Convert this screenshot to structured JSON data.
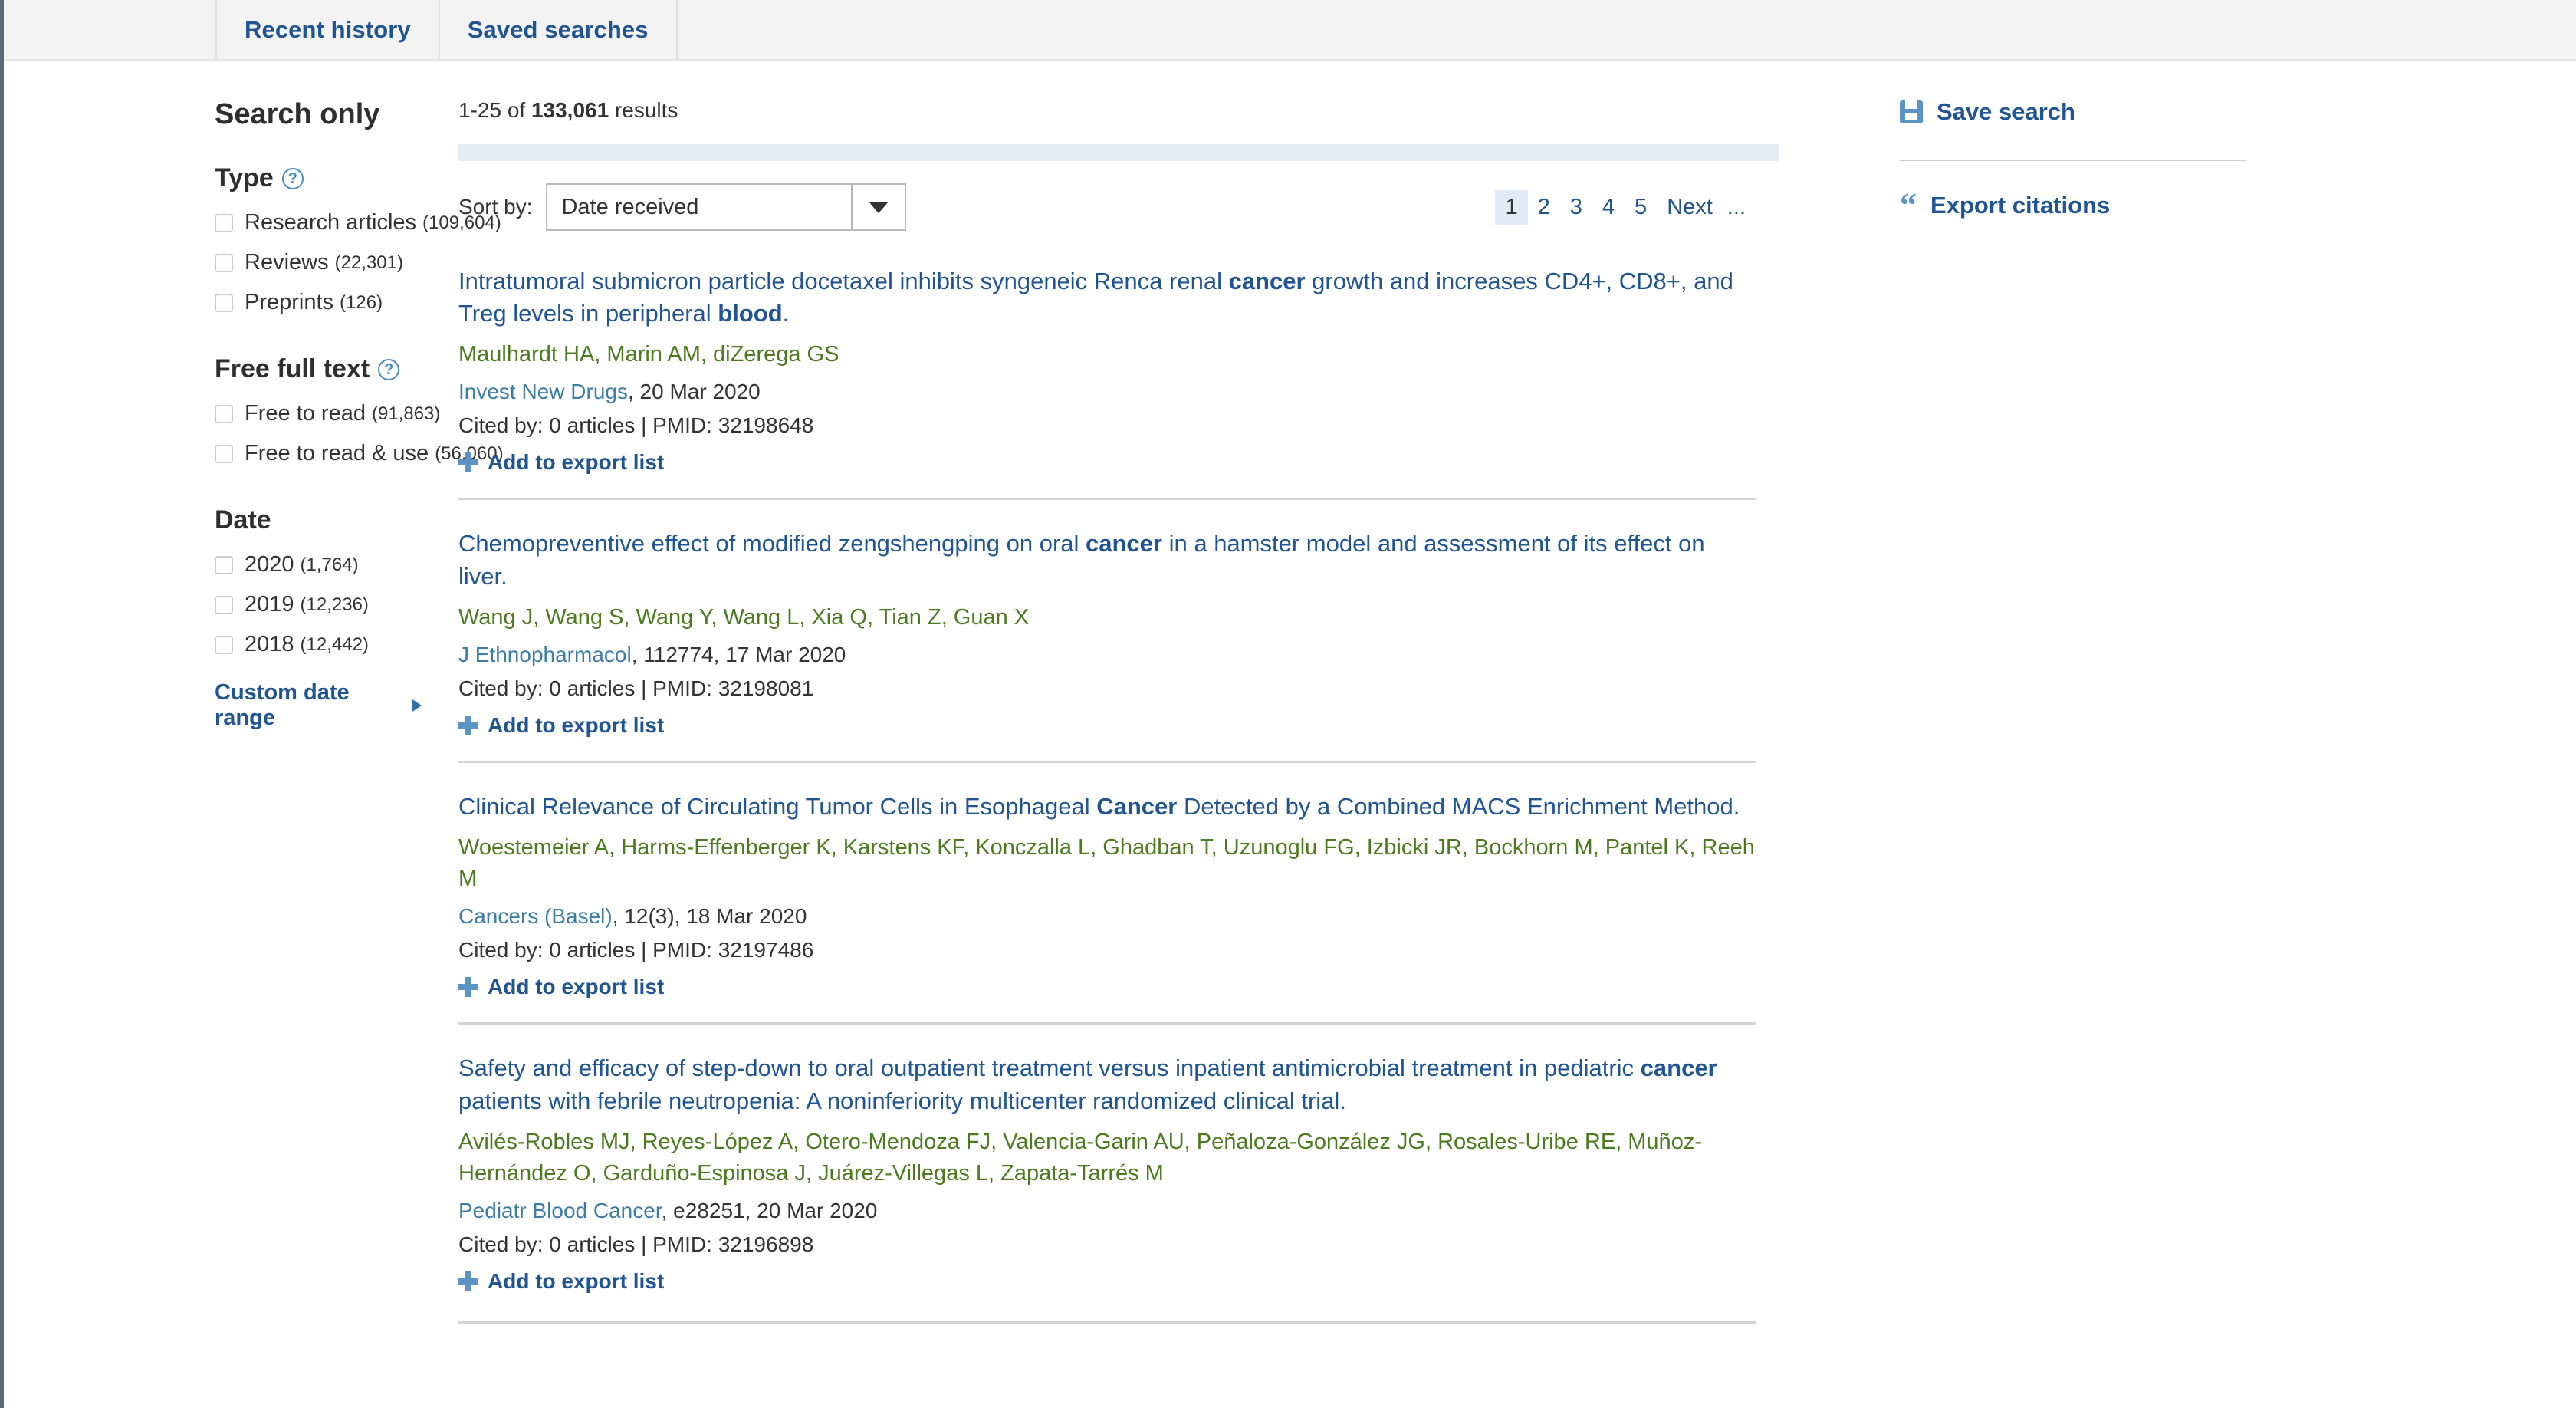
{
  "tabs": [
    {
      "label": "Recent history"
    },
    {
      "label": "Saved searches"
    }
  ],
  "sidebar": {
    "heading": "Search only",
    "facets": [
      {
        "title": "Type",
        "help": "?",
        "options": [
          {
            "label": "Research articles",
            "count": "(109,604)"
          },
          {
            "label": "Reviews",
            "count": "(22,301)"
          },
          {
            "label": "Preprints",
            "count": "(126)"
          }
        ]
      },
      {
        "title": "Free full text",
        "help": "?",
        "options": [
          {
            "label": "Free to read",
            "count": "(91,863)"
          },
          {
            "label": "Free to read & use",
            "count": "(56,060)"
          }
        ]
      },
      {
        "title": "Date",
        "help": "",
        "options": [
          {
            "label": "2020",
            "count": "(1,764)"
          },
          {
            "label": "2019",
            "count": "(12,236)"
          },
          {
            "label": "2018",
            "count": "(12,442)"
          }
        ]
      }
    ],
    "custom_date_range": "Custom date range"
  },
  "results": {
    "count_prefix": "1-25 of ",
    "count_total": "133,061",
    "count_suffix": " results",
    "sort_label": "Sort by:",
    "sort_value": "Date received",
    "pager": [
      {
        "label": "1",
        "current": true
      },
      {
        "label": "2",
        "current": false
      },
      {
        "label": "3",
        "current": false
      },
      {
        "label": "4",
        "current": false
      },
      {
        "label": "5",
        "current": false
      },
      {
        "label": "Next",
        "current": false
      },
      {
        "label": "...",
        "current": false
      }
    ],
    "export_label": "Add to export list",
    "articles": [
      {
        "title_pre": "Intratumoral submicron particle docetaxel inhibits syngeneic Renca renal ",
        "title_hl1": "cancer",
        "title_mid": " growth and increases CD4+, CD8+, and Treg levels in peripheral ",
        "title_hl2": "blood",
        "title_post": ".",
        "authors": "Maulhardt HA, Marin AM, diZerega GS",
        "journal": "Invest New Drugs",
        "source_rest": ", 20 Mar 2020",
        "cited": "Cited by: 0 articles | PMID: 32198648"
      },
      {
        "title_pre": "Chemopreventive effect of modified zengshengping on oral ",
        "title_hl1": "cancer",
        "title_mid": " in a hamster model and assessment of its effect on liver",
        "title_hl2": "",
        "title_post": ".",
        "authors": "Wang J, Wang S, Wang Y, Wang L, Xia Q, Tian Z, Guan X",
        "journal": "J Ethnopharmacol",
        "source_rest": ", 112774, 17 Mar 2020",
        "cited": "Cited by: 0 articles | PMID: 32198081"
      },
      {
        "title_pre": "Clinical Relevance of Circulating Tumor Cells in Esophageal ",
        "title_hl1": "Cancer",
        "title_mid": " Detected by a Combined MACS Enrichment Method",
        "title_hl2": "",
        "title_post": ".",
        "authors": "Woestemeier A, Harms-Effenberger K, Karstens KF, Konczalla L, Ghadban T, Uzunoglu FG, Izbicki JR, Bockhorn M, Pantel K, Reeh M",
        "journal": "Cancers (Basel)",
        "source_rest": ", 12(3), 18 Mar 2020",
        "cited": "Cited by: 0 articles | PMID: 32197486"
      },
      {
        "title_pre": "Safety and efficacy of step-down to oral outpatient treatment versus inpatient antimicrobial treatment in pediatric ",
        "title_hl1": "cancer",
        "title_mid": " patients with febrile neutropenia: A noninferiority multicenter randomized clinical trial",
        "title_hl2": "",
        "title_post": ".",
        "authors": "Avilés-Robles MJ, Reyes-López A, Otero-Mendoza FJ, Valencia-Garin AU, Peñaloza-González JG, Rosales-Uribe RE, Muñoz-Hernández O, Garduño-Espinosa J, Juárez-Villegas L, Zapata-Tarrés M",
        "journal": "Pediatr Blood Cancer",
        "source_rest": ", e28251, 20 Mar 2020",
        "cited": "Cited by: 0 articles | PMID: 32196898"
      }
    ]
  },
  "right_panel": {
    "save_search": "Save search",
    "export_citations": "Export citations"
  }
}
